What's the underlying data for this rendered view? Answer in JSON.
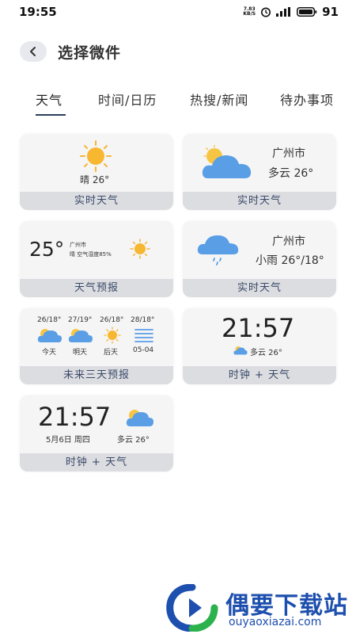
{
  "status_bar": {
    "time": "19:55",
    "net_speed_value": "7.83",
    "net_speed_unit": "KB/S",
    "battery": "91"
  },
  "header": {
    "title": "选择微件"
  },
  "tabs": [
    {
      "label": "天气",
      "active": true
    },
    {
      "label": "时间/日历",
      "active": false
    },
    {
      "label": "热搜/新闻",
      "active": false
    },
    {
      "label": "待办事项",
      "active": false
    }
  ],
  "widgets": {
    "w1": {
      "condition_temp": "晴 26°",
      "footer": "实时天气"
    },
    "w2": {
      "city": "广州市",
      "condition_temp": "多云 26°",
      "footer": "实时天气"
    },
    "w3": {
      "temp": "25°",
      "city": "广州市",
      "detail": "晴 空气湿度85%",
      "footer": "天气预报"
    },
    "w4": {
      "city": "广州市",
      "condition_temp": "小雨 26°/18°",
      "footer": "实时天气"
    },
    "w5": {
      "days": [
        {
          "range": "26/18°",
          "label": "今天",
          "icon": "cloud-sun-icon"
        },
        {
          "range": "27/19°",
          "label": "明天",
          "icon": "cloud-sun-icon"
        },
        {
          "range": "26/18°",
          "label": "后天",
          "icon": "sun-icon"
        },
        {
          "range": "28/18°",
          "label": "05-04",
          "icon": "fog-icon"
        }
      ],
      "footer": "未来三天预报"
    },
    "w6": {
      "time": "21:57",
      "weather": "多云 26°",
      "footer": "时钟 + 天气"
    },
    "w7": {
      "time": "21:57",
      "date": "5月6日 周四",
      "weather": "多云 26°",
      "footer": "时钟 + 天气"
    }
  },
  "watermark": {
    "title": "偶要下载站",
    "url": "ouyaoxiazai.com"
  },
  "colors": {
    "card_bg": "#f5f5f6",
    "card_footer": "#dcdde0",
    "sun": "#f7b731",
    "cloud": "#5a9ee6",
    "tab_underline": "#2c3e5c"
  }
}
